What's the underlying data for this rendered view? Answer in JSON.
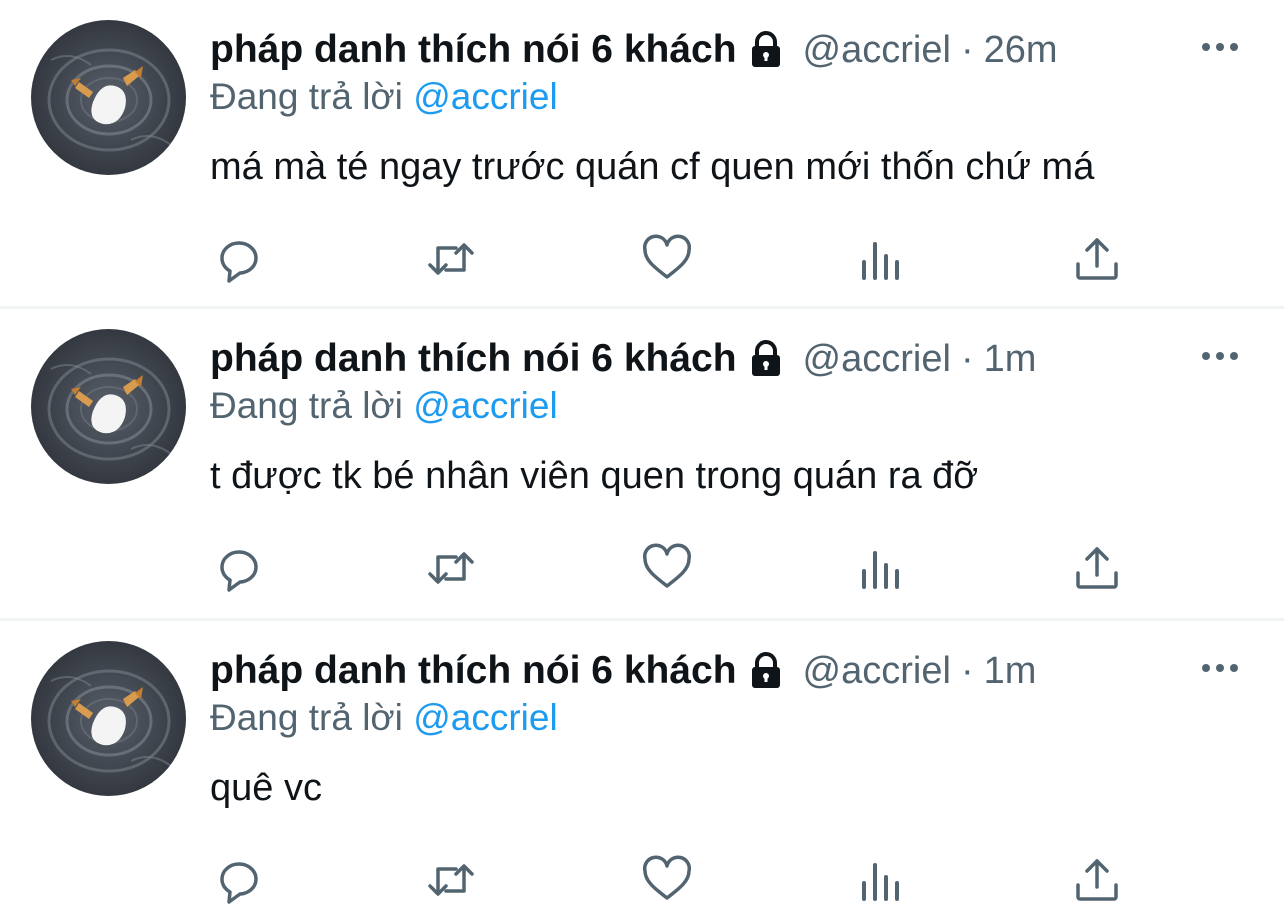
{
  "colors": {
    "text": "#0f1419",
    "muted": "#536471",
    "link": "#1d9bf0",
    "divider": "#eff3f4"
  },
  "tweets": [
    {
      "display_name": "pháp danh thích nói 6 khách",
      "handle": "@accriel",
      "separator": "·",
      "time": "26m",
      "replying_prefix": "Đang trả lời",
      "replying_to": "@accriel",
      "text": "má mà té ngay trước quán cf quen mới thốn chứ má",
      "icons": [
        "lock-icon",
        "more-icon",
        "reply-icon",
        "retweet-icon",
        "like-icon",
        "views-icon",
        "share-icon"
      ]
    },
    {
      "display_name": "pháp danh thích nói 6 khách",
      "handle": "@accriel",
      "separator": "·",
      "time": "1m",
      "replying_prefix": "Đang trả lời",
      "replying_to": "@accriel",
      "text": "t được tk bé nhân viên quen trong quán ra đỡ",
      "icons": [
        "lock-icon",
        "more-icon",
        "reply-icon",
        "retweet-icon",
        "like-icon",
        "views-icon",
        "share-icon"
      ]
    },
    {
      "display_name": "pháp danh thích nói 6 khách",
      "handle": "@accriel",
      "separator": "·",
      "time": "1m",
      "replying_prefix": "Đang trả lời",
      "replying_to": "@accriel",
      "text": "quê vc",
      "icons": [
        "lock-icon",
        "more-icon",
        "reply-icon",
        "retweet-icon",
        "like-icon",
        "views-icon",
        "share-icon"
      ]
    }
  ]
}
